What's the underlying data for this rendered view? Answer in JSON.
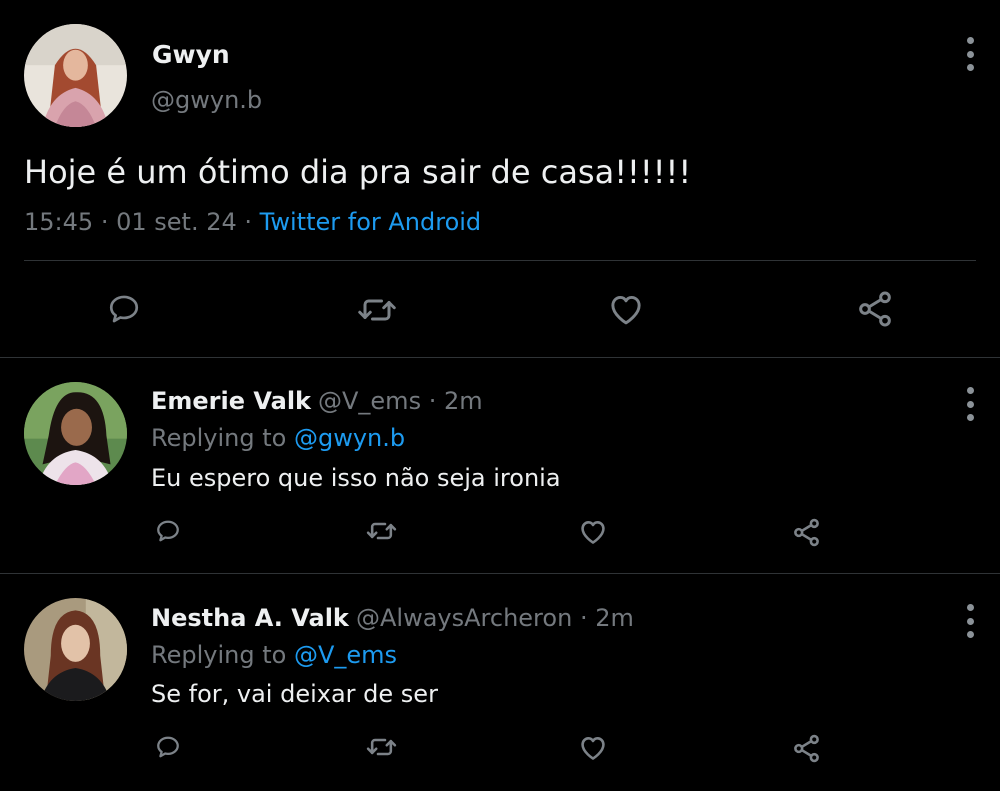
{
  "main_tweet": {
    "author_name": "Gwyn",
    "handle": "@gwyn.b",
    "text": "Hoje é um ótimo dia pra sair de casa!!!!!!",
    "time": "15:45",
    "date": "01 set. 24",
    "separator": "·",
    "client": "Twitter for Android",
    "avatar_icon": "profile-photo"
  },
  "replies": [
    {
      "author_name": "Emerie Valk",
      "handle": "@V_ems",
      "age": "2m",
      "separator": "·",
      "replying_prefix": "Replying to",
      "replying_to": "@gwyn.b",
      "text": "Eu espero que isso não seja ironia"
    },
    {
      "author_name": "Nestha A. Valk",
      "handle": "@AlwaysArcheron",
      "age": "2m",
      "separator": "·",
      "replying_prefix": "Replying to",
      "replying_to": "@V_ems",
      "text": "Se for, vai deixar de ser"
    }
  ],
  "icons": {
    "reply": "reply-icon",
    "retweet": "retweet-icon",
    "like": "heart-icon",
    "share": "share-icon",
    "more": "more-vertical-icon"
  },
  "colors": {
    "background": "#000000",
    "text": "#eef0f1",
    "secondary": "#74797e",
    "accent": "#1d9bf0",
    "icon": "#7c8288",
    "divider": "#2f3336"
  }
}
